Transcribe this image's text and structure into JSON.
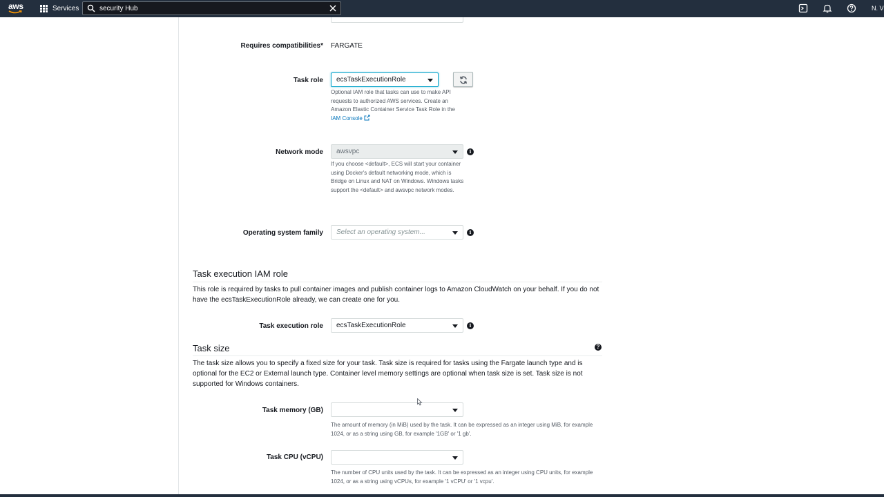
{
  "nav": {
    "logo_text": "aws",
    "services_label": "Services",
    "search_value": "security Hub",
    "region_label": "N. Vi"
  },
  "form": {
    "requires_compat_label": "Requires compatibilities*",
    "requires_compat_value": "FARGATE",
    "task_role_label": "Task role",
    "task_role_value": "ecsTaskExecutionRole",
    "task_role_help": "Optional IAM role that tasks can use to make API requests to authorized AWS services. Create an Amazon Elastic Container Service Task Role in the",
    "task_role_help_link": "IAM Console",
    "network_mode_label": "Network mode",
    "network_mode_value": "awsvpc",
    "network_mode_help": "If you choose <default>, ECS will start your container using Docker's default networking mode, which is Bridge on Linux and NAT on Windows. Windows tasks support the <default> and awsvpc network modes.",
    "os_family_label": "Operating system family",
    "os_family_placeholder": "Select an operating system..."
  },
  "exec_role_section": {
    "title": "Task execution IAM role",
    "description": "This role is required by tasks to pull container images and publish container logs to Amazon CloudWatch on your behalf. If you do not have the ecsTaskExecutionRole already, we can create one for you.",
    "field_label": "Task execution role",
    "field_value": "ecsTaskExecutionRole"
  },
  "task_size_section": {
    "title": "Task size",
    "description": "The task size allows you to specify a fixed size for your task. Task size is required for tasks using the Fargate launch type and is optional for the EC2 or External launch type. Container level memory settings are optional when task size is set. Task size is not supported for Windows containers.",
    "memory_label": "Task memory (GB)",
    "memory_value": "",
    "memory_help": "The amount of memory (in MiB) used by the task. It can be expressed as an integer using MiB, for example 1024, or as a string using GB, for example '1GB' or '1 gb'.",
    "cpu_label": "Task CPU (vCPU)",
    "cpu_value": "",
    "cpu_help": "The number of CPU units used by the task. It can be expressed as an integer using CPU units, for example 1024, or as a string using vCPUs, for example '1 vCPU' or '1 vcpu'."
  },
  "colors": {
    "nav_bg": "#232f3e",
    "link": "#0073bb",
    "focus_border": "#00a1c9"
  }
}
